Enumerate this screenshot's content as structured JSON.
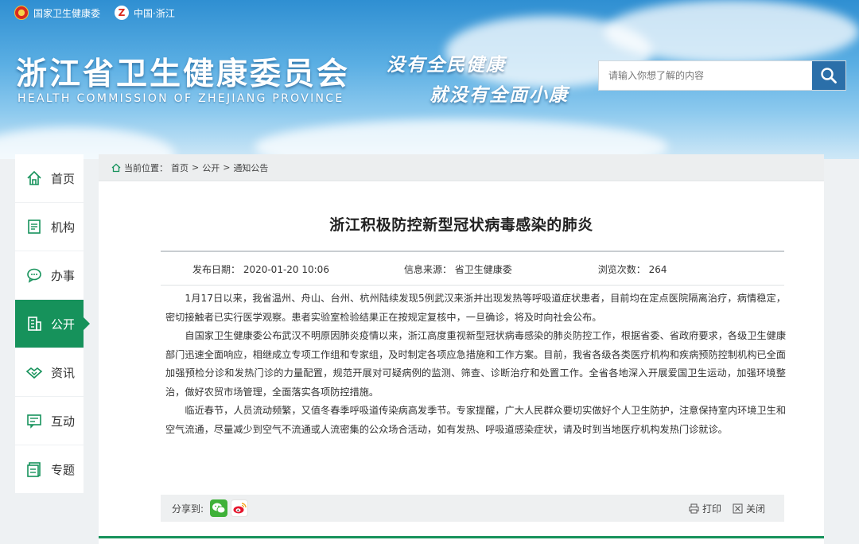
{
  "topbar": {
    "gov_label": "国家卫生健康委",
    "zj_label": "中国·浙江"
  },
  "header": {
    "title": "浙江省卫生健康委员会",
    "subtitle": "HEALTH COMMISSION OF ZHEJIANG PROVINCE",
    "slogan_line1": "没有全民健康",
    "slogan_line2": "就没有全面小康"
  },
  "search": {
    "placeholder": "请输入你想了解的内容"
  },
  "sidebar": {
    "items": [
      {
        "label": "首页",
        "icon": "home-icon"
      },
      {
        "label": "机构",
        "icon": "document-icon"
      },
      {
        "label": "办事",
        "icon": "chat-icon"
      },
      {
        "label": "公开",
        "icon": "building-icon",
        "active": true
      },
      {
        "label": "资讯",
        "icon": "handshake-icon"
      },
      {
        "label": "互动",
        "icon": "message-icon"
      },
      {
        "label": "专题",
        "icon": "folder-icon"
      }
    ]
  },
  "breadcrumb": {
    "prefix": "当前位置：",
    "items": [
      "首页",
      "公开",
      "通知公告"
    ],
    "separator": ">"
  },
  "article": {
    "title": "浙江积极防控新型冠状病毒感染的肺炎",
    "publish_date": "发布日期： 2020-01-20 10:06",
    "source": "信息来源： 省卫生健康委",
    "views": "浏览次数： 264",
    "paragraphs": [
      "1月17日以来，我省温州、舟山、台州、杭州陆续发现5例武汉来浙并出现发热等呼吸道症状患者，目前均在定点医院隔离治疗，病情稳定，密切接触者已实行医学观察。患者实验室检验结果正在按规定复核中，一旦确诊，将及时向社会公布。",
      "自国家卫生健康委公布武汉不明原因肺炎疫情以来，浙江高度重视新型冠状病毒感染的肺炎防控工作，根据省委、省政府要求，各级卫生健康部门迅速全面响应，相继成立专项工作组和专家组，及时制定各项应急措施和工作方案。目前，我省各级各类医疗机构和疾病预防控制机构已全面加强预检分诊和发热门诊的力量配置，规范开展对可疑病例的监测、筛查、诊断治疗和处置工作。全省各地深入开展爱国卫生运动，加强环境整治，做好农贸市场管理，全面落实各项防控措施。",
      "临近春节，人员流动频繁，又值冬春季呼吸道传染病高发季节。专家提醒，广大人民群众要切实做好个人卫生防护，注意保持室内环境卫生和空气流通，尽量减少到空气不流通或人流密集的公众场合活动，如有发热、呼吸道感染症状，请及时到当地医疗机构发热门诊就诊。"
    ]
  },
  "share": {
    "label": "分享到:",
    "print": "打印",
    "close": "关闭"
  },
  "colors": {
    "accent_green": "#16925b",
    "search_blue": "#2b6fa9"
  }
}
